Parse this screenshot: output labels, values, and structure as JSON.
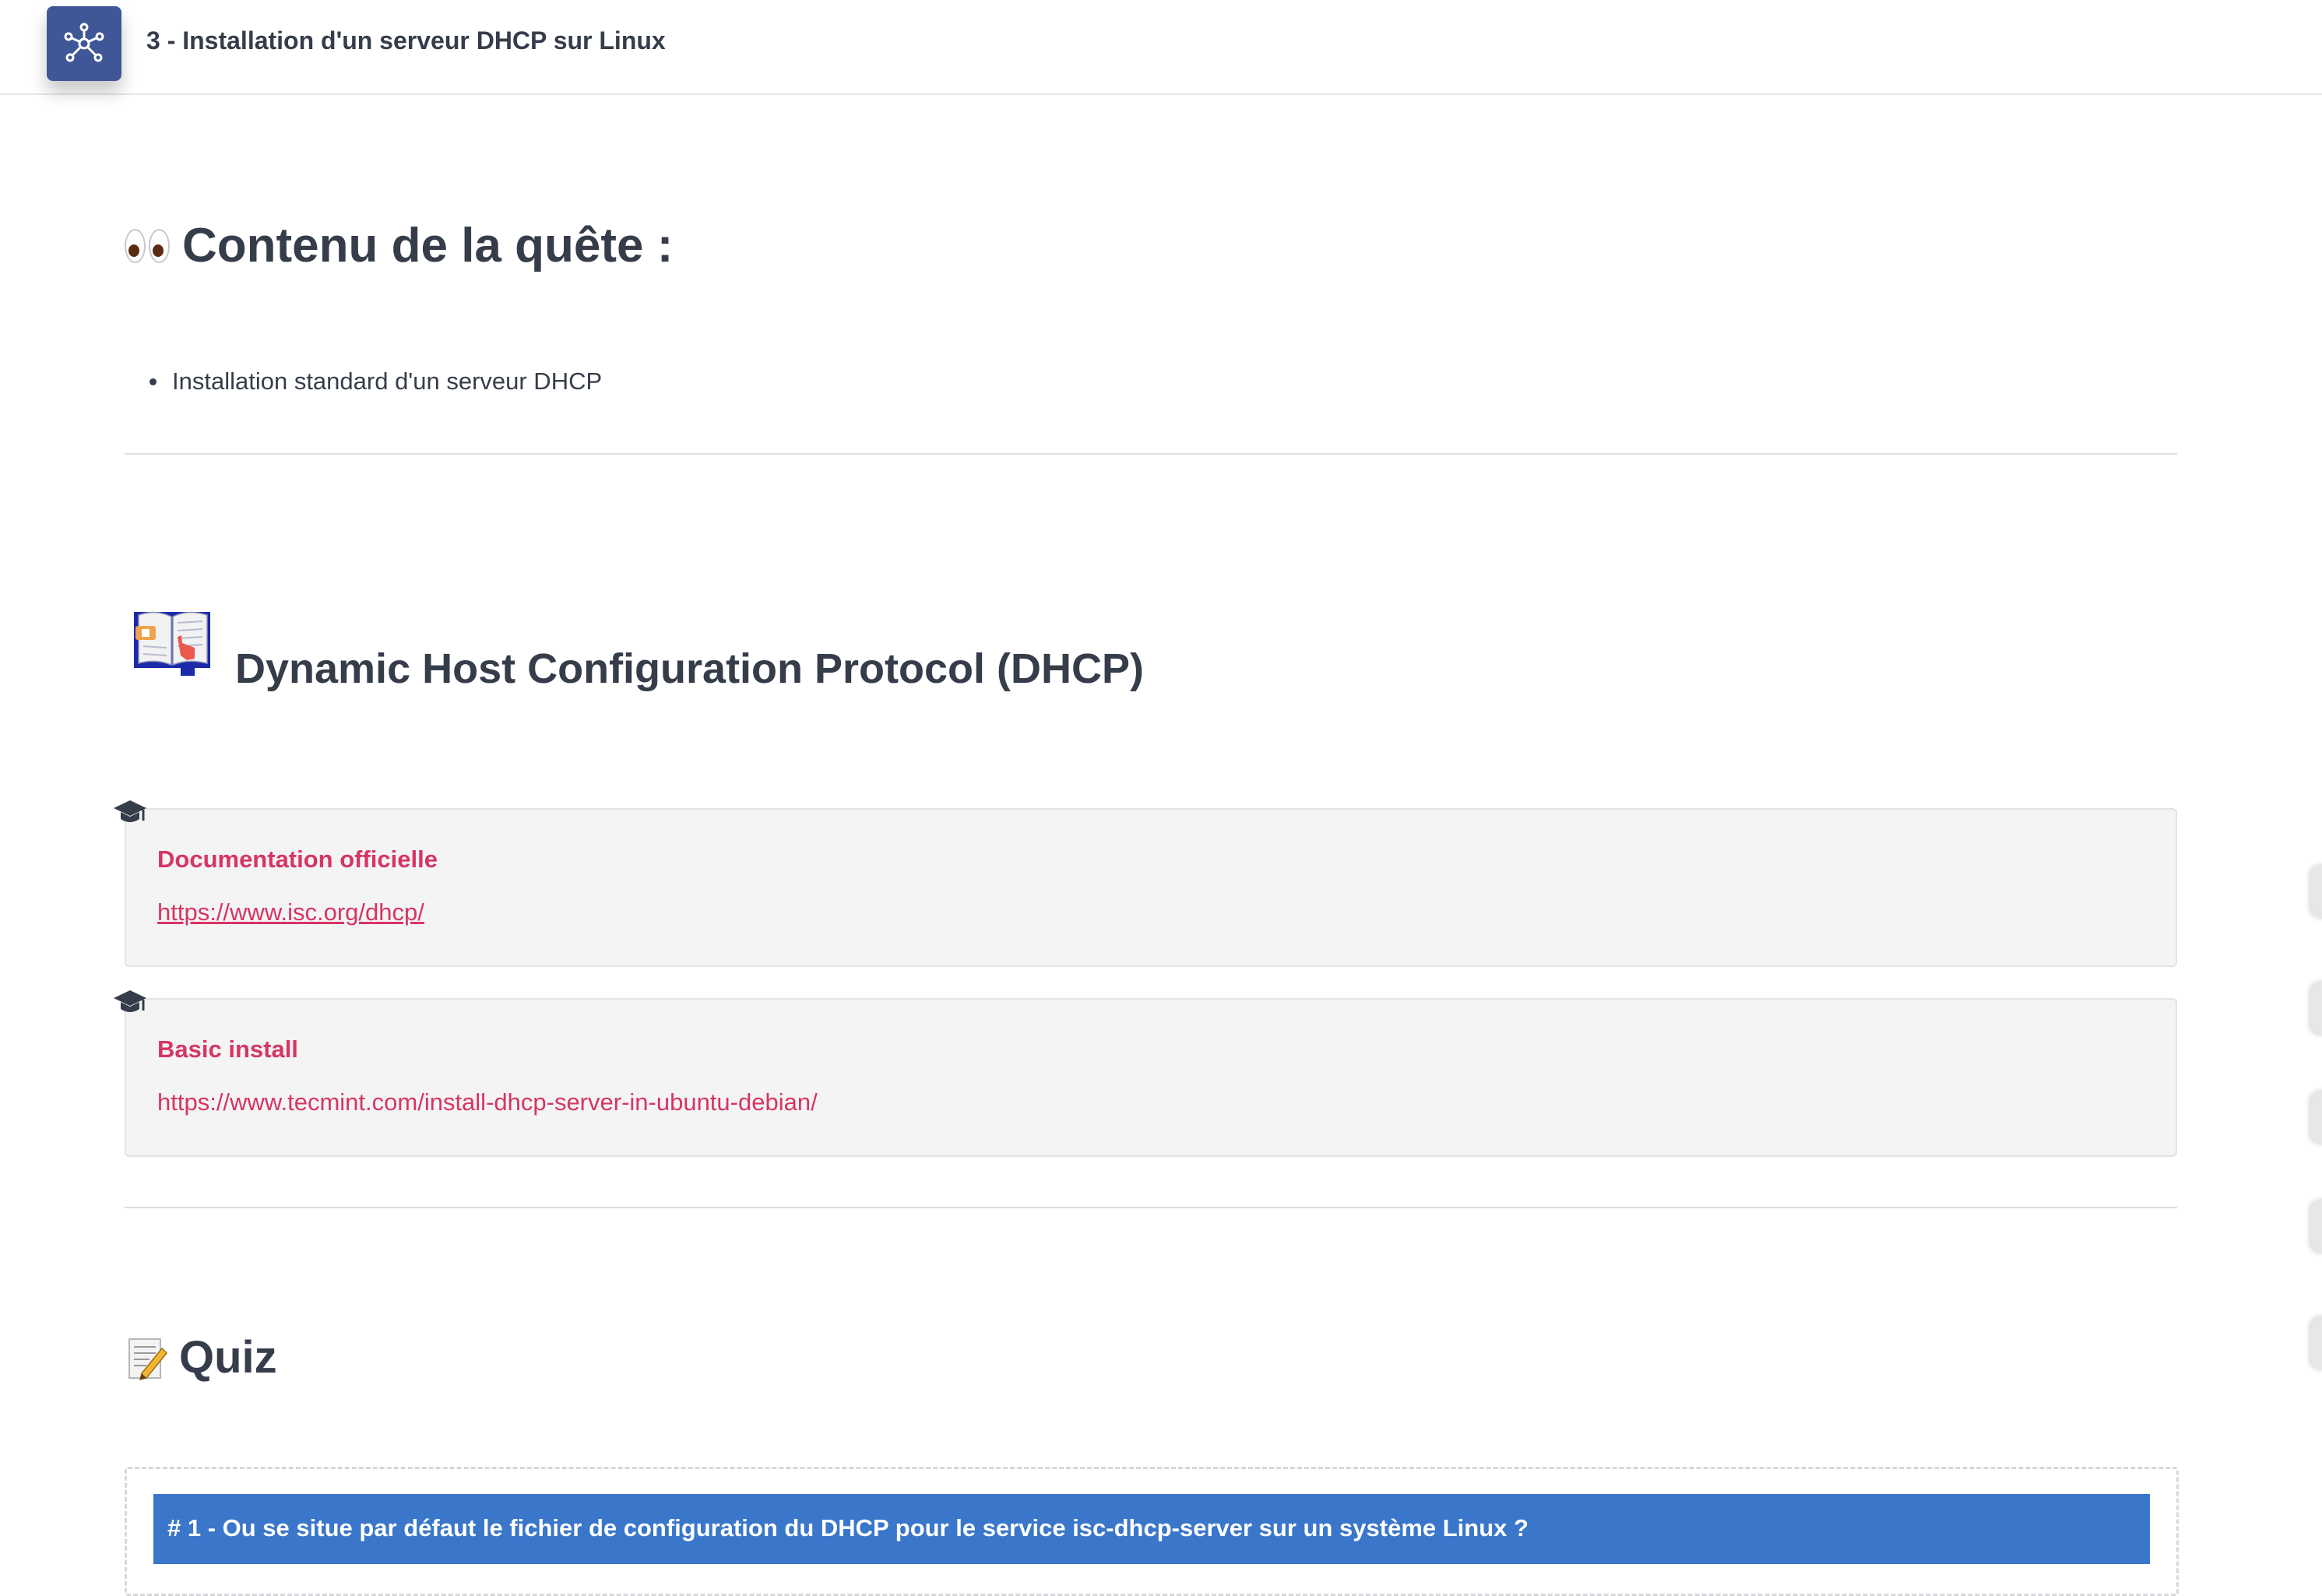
{
  "topbar": {
    "title": "3 - Installation d'un serveur DHCP sur Linux",
    "logo_icon": "network-nodes-icon"
  },
  "section_contenu": {
    "heading": "Contenu de la quête :",
    "emoji": "eyes-icon",
    "items": [
      "Installation standard d'un serveur DHCP"
    ]
  },
  "section_dhcp": {
    "heading": "Dynamic Host Configuration Protocol (DHCP)",
    "emoji": "open-book-pointer-icon",
    "resources": [
      {
        "icon": "graduation-cap-icon",
        "title": "Documentation officielle",
        "link": "https://www.isc.org/dhcp/"
      },
      {
        "icon": "graduation-cap-icon",
        "title": "Basic install",
        "link": "https://www.tecmint.com/install-dhcp-server-in-ubuntu-debian/"
      }
    ]
  },
  "section_quiz": {
    "heading": "Quiz",
    "emoji": "memo-pencil-icon",
    "question": "# 1 - Ou se situe par défaut le fichier de configuration du DHCP pour le service isc-dhcp-server sur un système Linux ?"
  },
  "colors": {
    "logo_bg": "#3f5797",
    "accent_pink": "#d63564",
    "quiz_blue": "#3a76c9",
    "text_dark": "#363d4a"
  }
}
